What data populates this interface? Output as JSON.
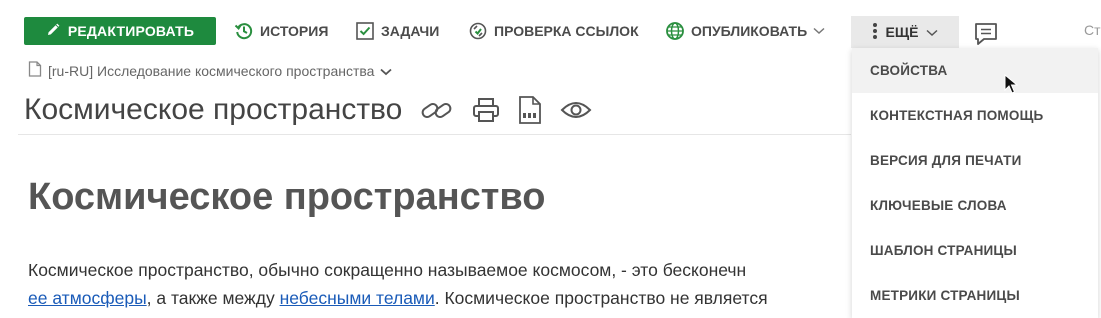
{
  "toolbar": {
    "edit_label": "РЕДАКТИРОВАТЬ",
    "history_label": "ИСТОРИЯ",
    "tasks_label": "ЗАДАЧИ",
    "link_check_label": "ПРОВЕРКА ССЫЛОК",
    "publish_label": "ОПУБЛИКОВАТЬ",
    "more_label": "ЕЩЁ",
    "cut_text": "Ст",
    "edit_color": "#1e8a3e"
  },
  "breadcrumb": {
    "label": "[ru-RU] Исследование космического пространства"
  },
  "page": {
    "title": "Космическое пространство",
    "heading": "Космическое пространство",
    "para_line1": "Космическое пространство, обычно сокращенно называемое космосом, - это бесконечн",
    "link1": "ее атмосферы",
    "para_mid": ", а также между ",
    "link2": "небесными телами",
    "para_end": ". Космическое пространство не является"
  },
  "more_menu": {
    "items": [
      {
        "label": "СВОЙСТВА",
        "active": true
      },
      {
        "label": "КОНТЕКСТНАЯ ПОМОЩЬ"
      },
      {
        "label": "ВЕРСИЯ ДЛЯ ПЕЧАТИ"
      },
      {
        "label": "КЛЮЧЕВЫЕ СЛОВА"
      },
      {
        "label": "ШАБЛОН СТРАНИЦЫ"
      },
      {
        "label": "МЕТРИКИ СТРАНИЦЫ"
      }
    ]
  },
  "icons": {
    "edit": "pencil-icon",
    "history": "history-clock-icon",
    "tasks": "checkbox-icon",
    "link_check": "link-check-icon",
    "publish": "globe-icon",
    "more": "vertical-dots-icon",
    "chat": "chat-bubble-icon",
    "copy_link": "link-icon",
    "print": "printer-icon",
    "pdf": "pdf-icon",
    "watch": "eye-icon"
  }
}
